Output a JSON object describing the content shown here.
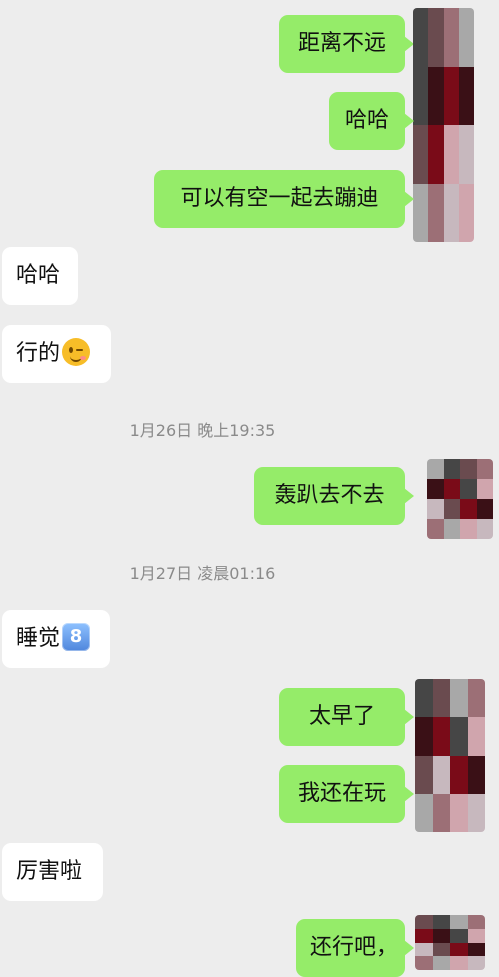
{
  "messages": [
    {
      "side": "out",
      "text": "距离不远"
    },
    {
      "side": "out",
      "text": "哈哈"
    },
    {
      "side": "out",
      "text": "可以有空一起去蹦迪"
    },
    {
      "side": "in",
      "text": "哈哈"
    },
    {
      "side": "in",
      "text": "行的",
      "emoji": "winking-face-icon"
    },
    {
      "side": "time",
      "text": "1月26日 晚上19:35"
    },
    {
      "side": "out",
      "text": "轰趴去不去"
    },
    {
      "side": "time",
      "text": "1月27日 凌晨01:16"
    },
    {
      "side": "in",
      "text": "睡觉",
      "emoji": "keycap-8-icon",
      "emoji_text": "8"
    },
    {
      "side": "out",
      "text": "太早了"
    },
    {
      "side": "out",
      "text": "我还在玩"
    },
    {
      "side": "in",
      "text": "厉害啦"
    },
    {
      "side": "out",
      "text": "还行吧，"
    }
  ],
  "theme": {
    "background": "#ededed",
    "outgoing": "#95ec69",
    "incoming": "#ffffff",
    "time": "#8a8a8a"
  },
  "avatar": {
    "semantic": "blurred-avatar-icon",
    "palette": [
      "#464646",
      "#6a4b4f",
      "#9c6f76",
      "#d0a5ad",
      "#7a0b18",
      "#3a1016",
      "#a8a8a8",
      "#c7b8be"
    ]
  }
}
